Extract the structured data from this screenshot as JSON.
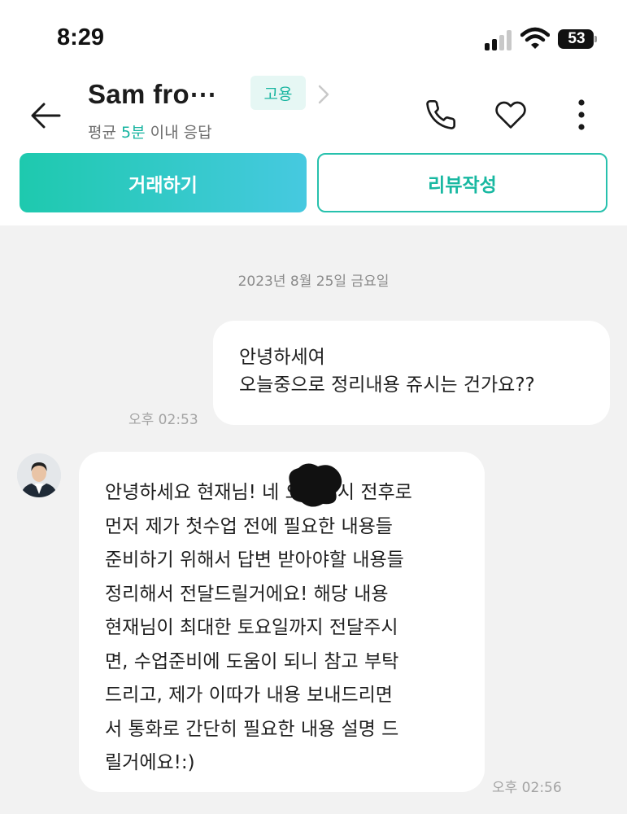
{
  "status_bar": {
    "time": "8:29",
    "battery": "53"
  },
  "header": {
    "title": "Sam fro⋯",
    "badge": "고용",
    "response_prefix": "평균 ",
    "response_highlight": "5분",
    "response_suffix": " 이내 응답",
    "icons": [
      "back-arrow-icon",
      "chevron-right-icon",
      "phone-icon",
      "heart-icon",
      "more-vertical-icon"
    ]
  },
  "actions": {
    "trade_label": "거래하기",
    "review_label": "리뷰작성"
  },
  "colors": {
    "accent": "#1ec9ae",
    "accent_end": "#46c9e0",
    "chat_background": "#f2f2f2"
  },
  "chat": {
    "date": "2023년 8월 25일 금요일",
    "outgoing": {
      "lines": [
        "안녕하세여",
        "오늘중으로 정리내용 쥬시는 건가요??"
      ],
      "time": "오후 02:53"
    },
    "incoming": {
      "lines": [
        "안녕하세요 현재님! 네 오늘 5시 전후로",
        "먼저 제가 첫수업 전에 필요한 내용들",
        "준비하기 위해서 답변 받아야할 내용들",
        "정리해서 전달드릴거에요! 해당 내용",
        "현재님이 최대한 토요일까지 전달주시",
        "면, 수업준비에 도움이 되니 참고 부탁",
        "드리고, 제가 이따가 내용 보내드리면",
        "서 통화로 간단히 필요한 내용 설명 드",
        "릴거에요!:)"
      ],
      "time": "오후 02:56"
    }
  }
}
